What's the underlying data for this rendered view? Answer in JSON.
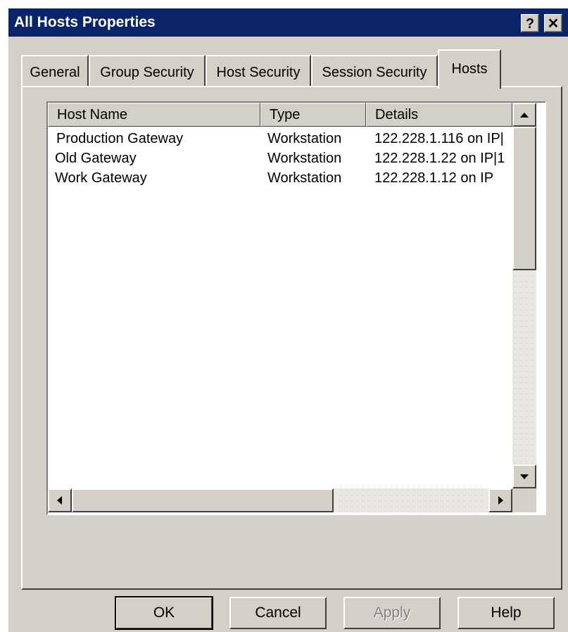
{
  "window": {
    "title": "All Hosts Properties",
    "help_button": "?",
    "close_button": "✕"
  },
  "tabs": [
    {
      "label": "General",
      "active": false
    },
    {
      "label": "Group Security",
      "active": false
    },
    {
      "label": "Host Security",
      "active": false
    },
    {
      "label": "Session Security",
      "active": false
    },
    {
      "label": "Hosts",
      "active": true
    }
  ],
  "hosts_list": {
    "columns": [
      "Host Name",
      "Type",
      "Details"
    ],
    "rows": [
      {
        "name": "Production Gateway",
        "type": "Workstation",
        "details": "122.228.1.116 on IP|"
      },
      {
        "name": "Old Gateway",
        "type": "Workstation",
        "details": "122.228.1.22 on IP|1"
      },
      {
        "name": "Work Gateway",
        "type": "Workstation",
        "details": "122.228.1.12 on IP"
      }
    ]
  },
  "buttons": {
    "ok": "OK",
    "cancel": "Cancel",
    "apply": "Apply",
    "help": "Help"
  },
  "icons": {
    "scroll_up": "up-arrow-icon",
    "scroll_down": "down-arrow-icon",
    "scroll_left": "left-arrow-icon",
    "scroll_right": "right-arrow-icon"
  }
}
